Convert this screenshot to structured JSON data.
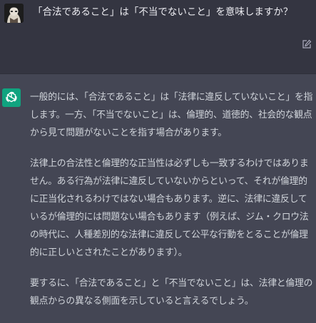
{
  "conversation": {
    "user_message": "「合法であること」は「不当でないこと」を意味しますか？",
    "assistant_paragraphs": [
      "一般的には、「合法であること」は「法律に違反していないこと」を指します。一方、「不当でないこと」は、倫理的、道徳的、社会的な観点から見て問題がないことを指す場合があります。",
      "法律上の合法性と倫理的な正当性は必ずしも一致するわけではありません。ある行為が法律に違反していないからといって、それが倫理的に正当化されるわけではない場合もあります。逆に、法律に違反しているが倫理的には問題ない場合もあります（例えば、ジム・クロウ法の時代に、人種差別的な法律に違反して公平な行動をとることが倫理的に正しいとされたことがあります）。",
      "要するに、「合法であること」と「不当でないこと」は、法律と倫理の観点からの異なる側面を示していると言えるでしょう。"
    ]
  },
  "icons": {
    "user_avatar": "user-avatar-icon",
    "edit": "pencil-edit-icon",
    "assistant_avatar": "openai-logo-icon"
  },
  "colors": {
    "user_bg": "#343541",
    "assistant_bg": "#444654",
    "assistant_avatar_bg": "#10a37f",
    "text": "#d1d5db"
  }
}
